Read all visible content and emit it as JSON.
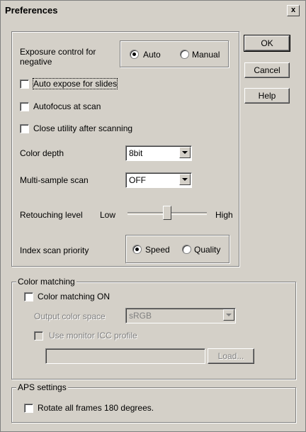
{
  "window": {
    "title": "Preferences",
    "close_label": "x"
  },
  "buttons": {
    "ok": "OK",
    "cancel": "Cancel",
    "help": "Help"
  },
  "settings": {
    "exposure_label": "Exposure control for negative",
    "exposure_options": [
      "Auto",
      "Manual"
    ],
    "exposure_selected": "Auto",
    "auto_expose_slides": "Auto expose for slides",
    "autofocus_scan": "Autofocus at scan",
    "close_utility": "Close utility after scanning",
    "color_depth_label": "Color depth",
    "color_depth_value": "8bit",
    "multisample_label": "Multi-sample scan",
    "multisample_value": "OFF",
    "retouching_label": "Retouching level",
    "retouching_low": "Low",
    "retouching_high": "High",
    "retouching_level": 0.5,
    "index_priority_label": "Index scan priority",
    "index_priority_options": [
      "Speed",
      "Quality"
    ],
    "index_priority_selected": "Speed"
  },
  "color_matching": {
    "group_label": "Color matching",
    "enable_label": "Color matching ON",
    "output_space_label": "Output color space",
    "output_space_value": "sRGB",
    "monitor_icc_label": "Use monitor ICC profile",
    "profile_path": "",
    "load_label": "Load..."
  },
  "aps": {
    "group_label": "APS settings",
    "rotate_label": "Rotate all frames 180 degrees."
  }
}
